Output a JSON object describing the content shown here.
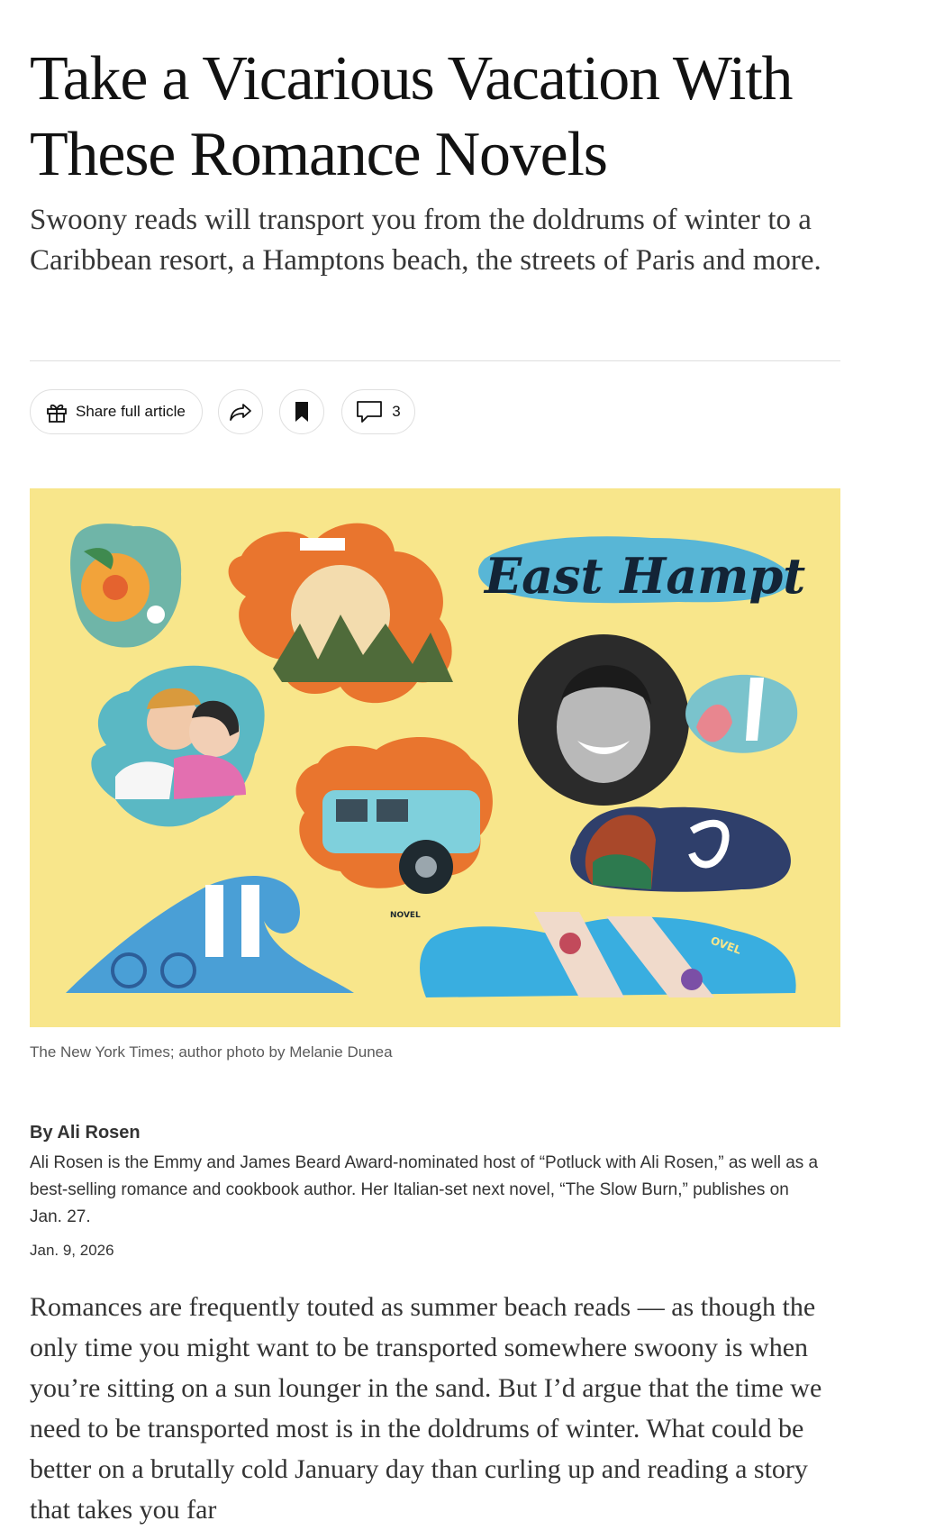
{
  "article": {
    "headline": "Take a Vicarious Vacation With These Romance Novels",
    "summary": "Swoony reads will transport you from the doldrums of winter to a Caribbean resort, a Hamptons beach, the streets of Paris and more.",
    "toolbar": {
      "share_label": "Share full article",
      "comment_count": "3"
    },
    "hero": {
      "credit": "The New York Times; author photo by Melanie Dunea",
      "cover_text_1": "East Hampt",
      "cover_text_2": "NOVEL",
      "cover_text_3": "OVEL",
      "background_color": "#f8e68b"
    },
    "byline": {
      "author": "By Ali Rosen",
      "bio": "Ali Rosen is the Emmy and James Beard Award-nominated host of “Potluck with Ali Rosen,” as well as a best-selling romance and cookbook author. Her Italian-set next novel, “The Slow Burn,” publishes on Jan. 27.",
      "date": "Jan. 9, 2026"
    },
    "body_text": "Romances are frequently touted as summer beach reads — as though the only time you might want to be transported somewhere swoony is when you’re sitting on a sun lounger in the sand. But I’d argue that the time we need to be transported most is in the doldrums of winter. What could be better on a brutally cold January day than curling up and reading a story that takes you far"
  },
  "icons": [
    "gift-icon",
    "share-arrow-icon",
    "bookmark-icon",
    "comment-icon"
  ]
}
